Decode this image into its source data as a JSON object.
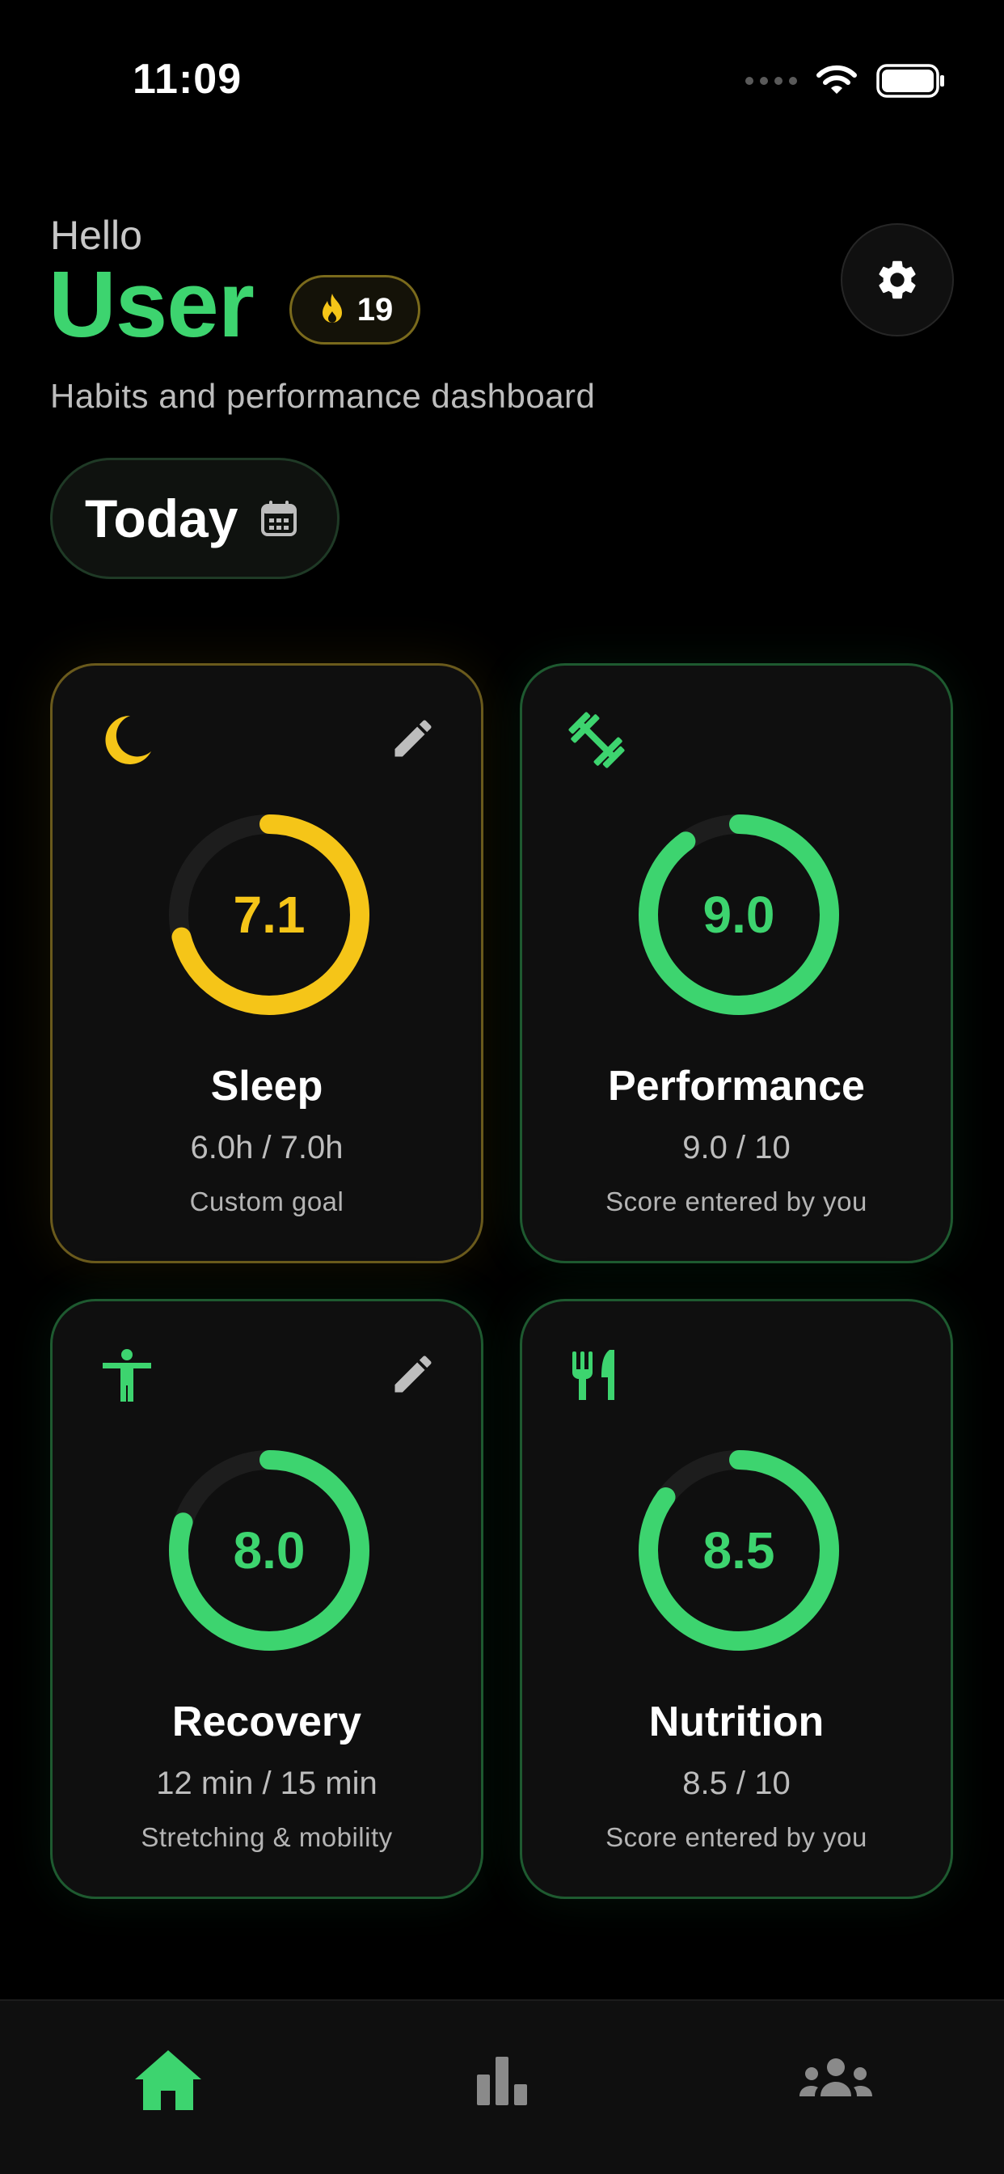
{
  "status_bar": {
    "time": "11:09"
  },
  "header": {
    "greeting": "Hello",
    "user_name": "User",
    "streak": "19",
    "subtitle": "Habits and performance dashboard"
  },
  "date_selector": {
    "label": "Today"
  },
  "colors": {
    "accent_green": "#3dd46f",
    "accent_yellow": "#f5c518",
    "background": "#000000",
    "card": "#0f0f0f"
  },
  "cards": [
    {
      "key": "sleep",
      "icon": "moon-icon",
      "title": "Sleep",
      "score": "7.1",
      "progress": 0.71,
      "metric": "6.0h / 7.0h",
      "note": "Custom goal",
      "editable": true
    },
    {
      "key": "performance",
      "icon": "dumbbell-icon",
      "title": "Performance",
      "score": "9.0",
      "progress": 0.9,
      "metric": "9.0 / 10",
      "note": "Score entered by you",
      "editable": false
    },
    {
      "key": "recovery",
      "icon": "person-stretch-icon",
      "title": "Recovery",
      "score": "8.0",
      "progress": 0.8,
      "metric": "12 min / 15 min",
      "note": "Stretching & mobility",
      "editable": true
    },
    {
      "key": "nutrition",
      "icon": "fork-knife-icon",
      "title": "Nutrition",
      "score": "8.5",
      "progress": 0.85,
      "metric": "8.5 / 10",
      "note": "Score entered by you",
      "editable": false
    }
  ],
  "tab_bar": [
    {
      "icon": "home-icon",
      "active": true
    },
    {
      "icon": "bar-chart-icon",
      "active": false
    },
    {
      "icon": "community-icon",
      "active": false
    }
  ]
}
